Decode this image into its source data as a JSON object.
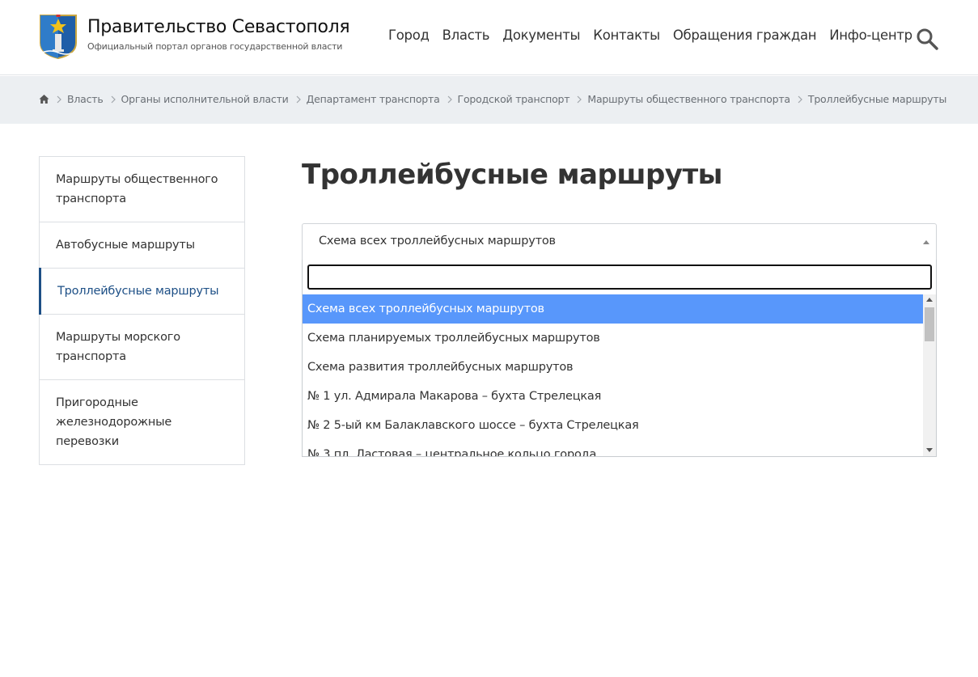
{
  "header": {
    "title": "Правительство Севастополя",
    "subtitle": "Официальный портал органов государственной власти",
    "nav": [
      "Город",
      "Власть",
      "Документы",
      "Контакты",
      "Обращения граждан",
      "Инфо-центр"
    ]
  },
  "breadcrumb": [
    "Власть",
    "Органы исполнительной власти",
    "Департамент транспорта",
    "Городской транспорт",
    "Маршруты общественного транспорта",
    "Троллейбусные маршруты"
  ],
  "sidebar": {
    "items": [
      "Маршруты общественного транспорта",
      "Автобусные маршруты",
      "Троллейбусные маршруты",
      "Маршруты морского транспорта",
      "Пригородные железнодорожные перевозки"
    ],
    "active_index": 2
  },
  "page_title": "Троллейбусные маршруты",
  "select": {
    "value": "Схема всех троллейбусных маршрутов",
    "search_value": "",
    "options": [
      "Схема всех троллейбусных маршрутов",
      "Схема планируемых троллейбусных маршрутов",
      "Схема развития троллейбусных маршрутов",
      "№ 1 ул. Адмирала Макарова – бухта Стрелецкая",
      "№ 2 5-ый км Балаклавского шоссе – бухта Стрелецкая",
      "№ 3 пл. Ластовая – центральное кольцо города"
    ],
    "selected_index": 0
  },
  "colors": {
    "accent": "#1d4f86",
    "option_highlight": "#5897fb",
    "breadcrumb_bg": "#eceff2"
  }
}
